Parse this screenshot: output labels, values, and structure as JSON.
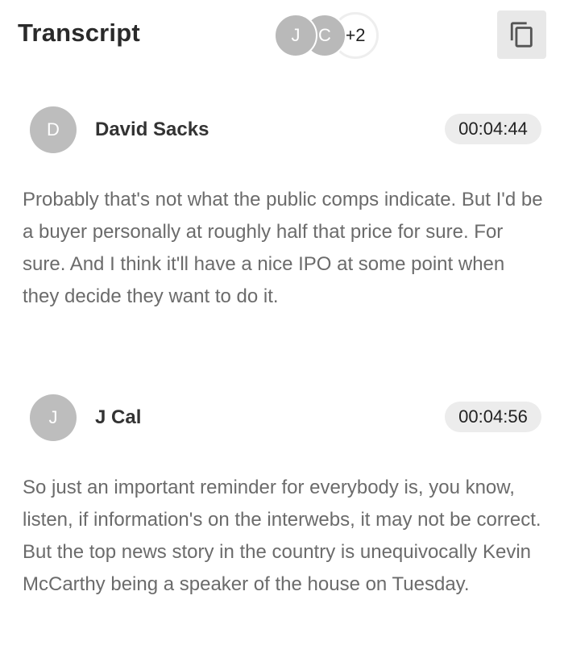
{
  "header": {
    "title": "Transcript",
    "participants": [
      {
        "initial": "J"
      },
      {
        "initial": "C"
      }
    ],
    "more_count": "+2",
    "copy_icon": "copy-icon"
  },
  "entries": [
    {
      "initial": "D",
      "speaker": "David Sacks",
      "timestamp": "00:04:44",
      "text": "Probably that's not what the public comps indicate. But I'd be a buyer personally at roughly half that price for sure. For sure. And I think it'll have a nice IPO at some point when they decide they want to do it."
    },
    {
      "initial": "J",
      "speaker": "J Cal",
      "timestamp": "00:04:56",
      "text": "So just an important reminder for everybody is, you know, listen, if information's on the interwebs, it may not be correct. But the top news story in the country is unequivocally Kevin McCarthy being a speaker of the house on Tuesday."
    }
  ]
}
